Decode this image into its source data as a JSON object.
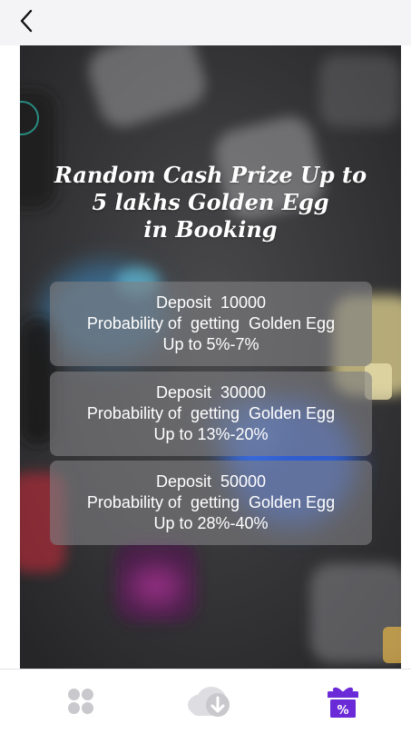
{
  "nav": {
    "back_icon": "chevron-left-icon"
  },
  "banner": {
    "headline": [
      "Random  Cash Prize Up to",
      "5 lakhs Golden Egg",
      "in Booking"
    ],
    "tiers": [
      {
        "deposit": "Deposit  10000",
        "probability": "Probability of  getting  Golden Egg",
        "range": "Up to 5%-7%"
      },
      {
        "deposit": "Deposit  30000",
        "probability": "Probability of  getting  Golden Egg",
        "range": "Up to 13%-20%"
      },
      {
        "deposit": "Deposit  50000",
        "probability": "Probability of  getting  Golden Egg",
        "range": "Up to 28%-40%"
      }
    ]
  },
  "tabbar": {
    "tabs": [
      {
        "icon": "apps-grid-icon",
        "active": false
      },
      {
        "icon": "cloud-download-icon",
        "active": false
      },
      {
        "icon": "gift-percent-icon",
        "active": true
      }
    ],
    "active_color": "#6a2ad8",
    "inactive_color": "#c9c9cd"
  }
}
